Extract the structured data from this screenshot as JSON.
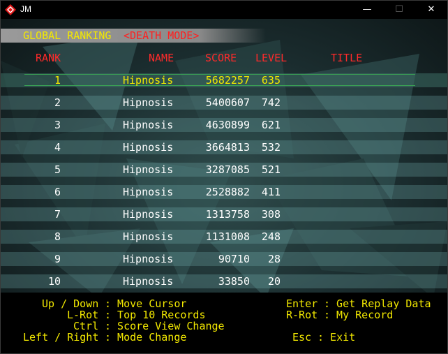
{
  "window": {
    "title": "JM",
    "min_glyph": "—",
    "max_glyph": "☐",
    "close_glyph": "✕"
  },
  "header": {
    "title": "GLOBAL RANKING",
    "mode": "<DEATH MODE>"
  },
  "columns": {
    "rank": "RANK",
    "name": "NAME",
    "score": "SCORE",
    "level": "LEVEL",
    "title": "TITLE"
  },
  "rows": [
    {
      "rank": "1",
      "name": "Hipnosis",
      "score": "5682257",
      "level": "635",
      "selected": true
    },
    {
      "rank": "2",
      "name": "Hipnosis",
      "score": "5400607",
      "level": "742"
    },
    {
      "rank": "3",
      "name": "Hipnosis",
      "score": "4630899",
      "level": "621"
    },
    {
      "rank": "4",
      "name": "Hipnosis",
      "score": "3664813",
      "level": "532"
    },
    {
      "rank": "5",
      "name": "Hipnosis",
      "score": "3287085",
      "level": "521"
    },
    {
      "rank": "6",
      "name": "Hipnosis",
      "score": "2528882",
      "level": "411"
    },
    {
      "rank": "7",
      "name": "Hipnosis",
      "score": "1313758",
      "level": "308"
    },
    {
      "rank": "8",
      "name": "Hipnosis",
      "score": "1131008",
      "level": "248"
    },
    {
      "rank": "9",
      "name": "Hipnosis",
      "score": "90710",
      "level": "28"
    },
    {
      "rank": "10",
      "name": "Hipnosis",
      "score": "33850",
      "level": "20"
    }
  ],
  "help": {
    "updown_key": "Up / Down",
    "updown_action": ": Move Cursor",
    "lrot_key": "L-Rot",
    "lrot_action": ": Top 10 Records",
    "ctrl_key": "Ctrl",
    "ctrl_action": ": Score View Change",
    "leftright_key": "Left / Right",
    "leftright_action": ": Mode Change",
    "enter_key": "Enter",
    "enter_action": ": Get Replay Data",
    "rrot_key": "R-Rot",
    "rrot_action": ": My Record",
    "esc_key": "Esc",
    "esc_action": ": Exit"
  },
  "colors": {
    "header_yellow": "#f2e800",
    "mode_red": "#ff2020",
    "column_red": "#ff2a2a",
    "selection_green": "#38e040"
  }
}
